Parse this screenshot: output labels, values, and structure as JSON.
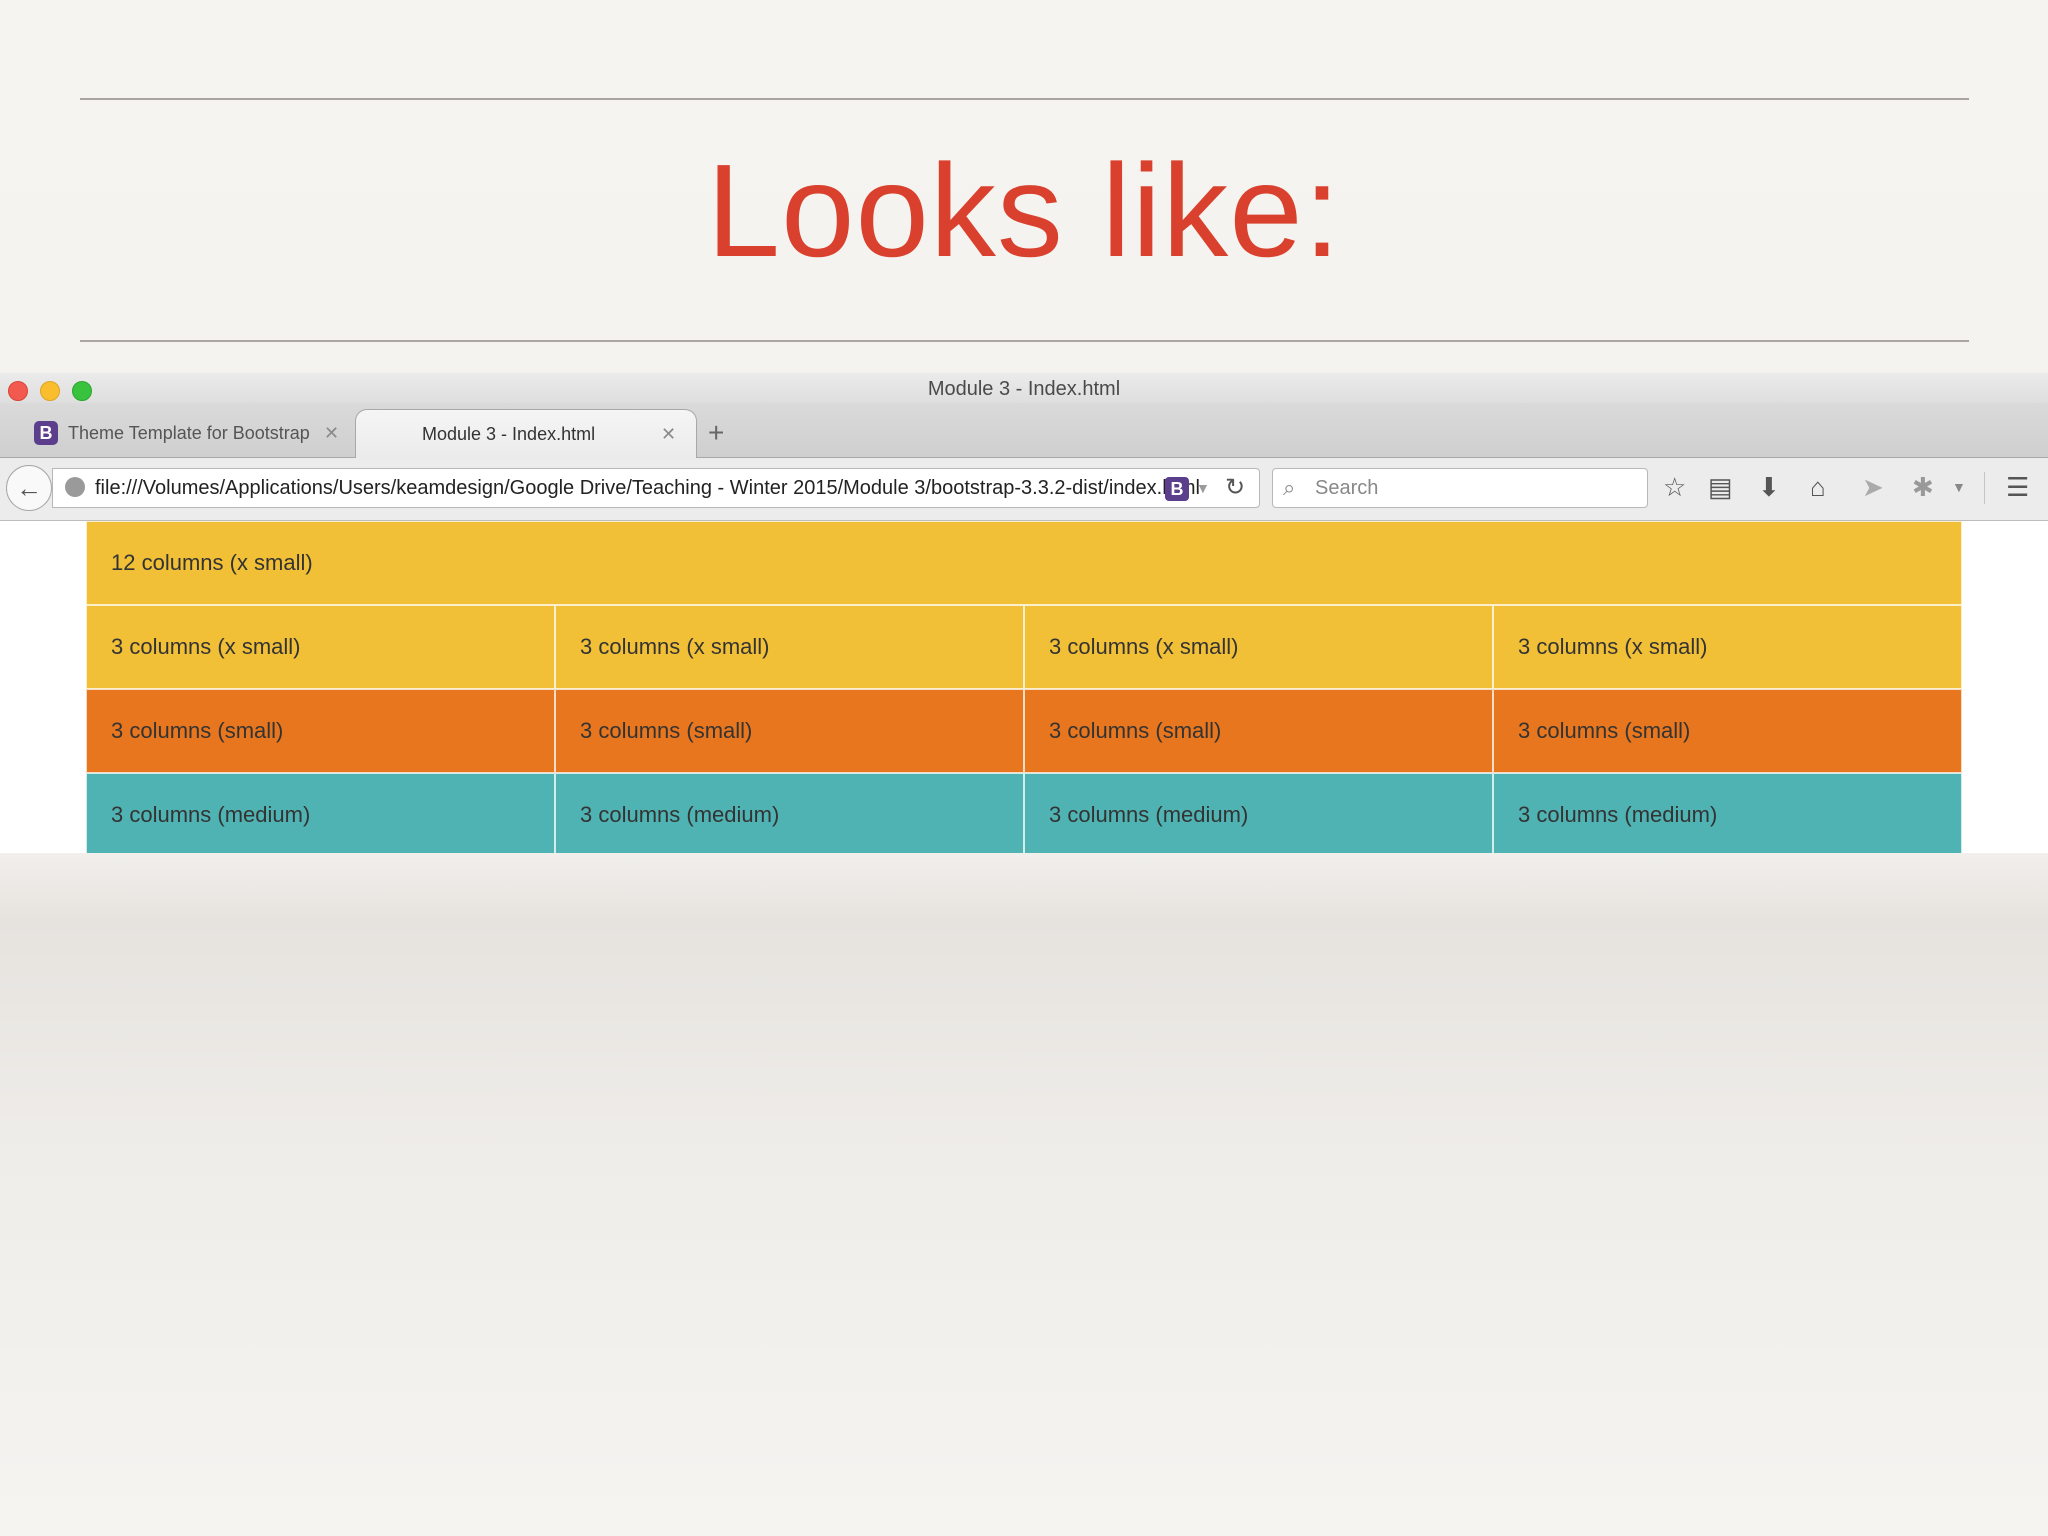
{
  "slide": {
    "title": "Looks like:"
  },
  "window": {
    "title": "Module 3 - Index.html"
  },
  "tabs": [
    {
      "label": "Theme Template for Bootstrap",
      "favicon": "B",
      "active": false
    },
    {
      "label": "Module 3 - Index.html",
      "active": true
    }
  ],
  "toolbar": {
    "url": "file:///Volumes/Applications/Users/keamdesign/Google Drive/Teaching - Winter 2015/Module 3/bootstrap-3.3.2-dist/index.html",
    "url_badge": "B",
    "search_placeholder": "Search"
  },
  "grid": {
    "row1": [
      "12 columns (x small)"
    ],
    "row2": [
      "3 columns (x small)",
      "3 columns (x small)",
      "3 columns (x small)",
      "3 columns (x small)"
    ],
    "row3": [
      "3 columns (small)",
      "3 columns (small)",
      "3 columns (small)",
      "3 columns (small)"
    ],
    "row4": [
      "3 columns (medium)",
      "3 columns (medium)",
      "3 columns (medium)",
      "3 columns (medium)"
    ]
  },
  "colors": {
    "xsmall": "#f2c037",
    "small": "#e8761f",
    "medium": "#50b3b3",
    "title": "#d9412e"
  }
}
